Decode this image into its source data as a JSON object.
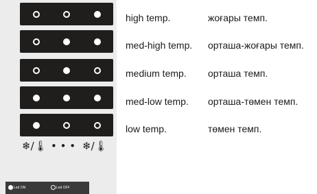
{
  "rows": [
    {
      "en": "high temp.",
      "kk": "жоғары темп.",
      "leds": [
        false,
        false,
        true
      ]
    },
    {
      "en": "med-high temp.",
      "kk": "орташа-жоғары темп.",
      "leds": [
        false,
        true,
        true
      ]
    },
    {
      "en": "medium temp.",
      "kk": "орташа темп.",
      "leds": [
        false,
        true,
        false
      ]
    },
    {
      "en": "med-low temp.",
      "kk": "орташа-төмен темп.",
      "leds": [
        true,
        true,
        true
      ]
    },
    {
      "en": "low temp.",
      "kk": "төмен темп.",
      "leds": [
        true,
        false,
        false
      ]
    }
  ],
  "symbols": {
    "left": "❄/🌡",
    "dots": "• • •",
    "right": "❄/🌡"
  },
  "legend": {
    "on_label": "Led ON",
    "off_label": "Led OFF"
  },
  "colors": {
    "bar": "#1f1e1c",
    "panel": "#ececec",
    "legend_bg": "#3a3a3a"
  }
}
